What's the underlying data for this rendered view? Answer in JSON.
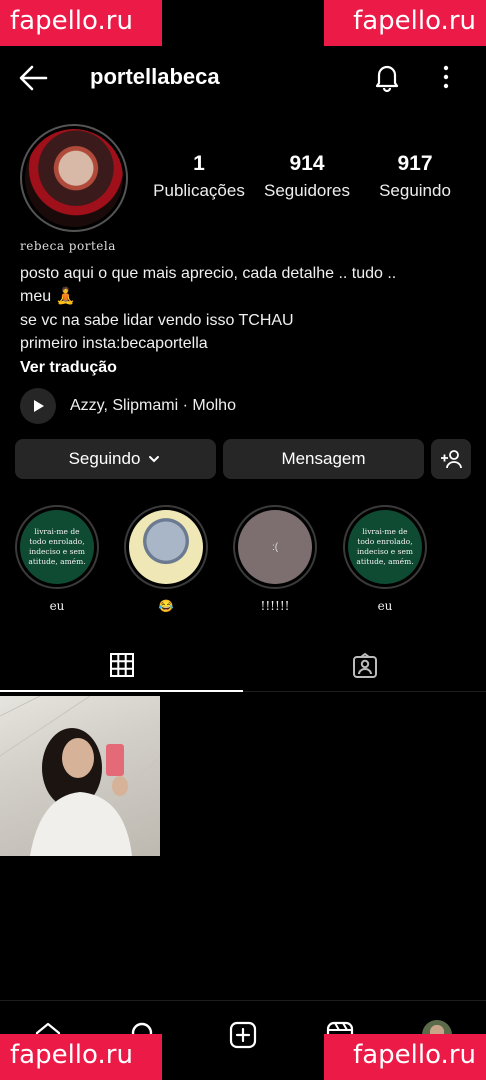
{
  "watermark": "fapello.ru",
  "status_bar": {
    "left_text": "",
    "right_text": ""
  },
  "header": {
    "username": "portellabeca"
  },
  "stats": [
    {
      "value": "1",
      "label": "Publicações"
    },
    {
      "value": "914",
      "label": "Seguidores"
    },
    {
      "value": "917",
      "label": "Seguindo"
    }
  ],
  "bio": {
    "display_name": "rebeca portela",
    "lines": [
      "posto aqui o que mais aprecio, cada detalhe .. tudo ..",
      "meu 🧘",
      "se vc na sabe lidar vendo isso TCHAU",
      "primeiro insta:becaportella"
    ],
    "translate_link": "Ver tradução"
  },
  "music": {
    "label": "Azzy, Slipmami · Molho"
  },
  "actions": {
    "following": "Seguindo",
    "message": "Mensagem"
  },
  "highlights": [
    {
      "cover_text": "livrai-me de todo enrolado, indeciso e sem atitude, amém.",
      "label": "eu"
    },
    {
      "cover_text": "",
      "label": "😂"
    },
    {
      "cover_text": ":(",
      "label": "!!!!!!"
    },
    {
      "cover_text": "livrai-me de todo enrolado, indeciso e sem atitude, amém.",
      "label": "eu"
    }
  ],
  "icons": {
    "back": "back-arrow-icon",
    "bell": "bell-icon",
    "more": "more-vertical-icon",
    "play": "play-icon",
    "chevron": "chevron-down-icon",
    "add_user": "add-user-icon",
    "grid": "grid-icon",
    "tagged": "tagged-icon",
    "home": "home-icon",
    "search": "search-icon",
    "create": "create-icon",
    "reels": "reels-icon"
  },
  "colors": {
    "background": "#000000",
    "button": "#262626",
    "watermark": "#ec1a47",
    "highlight_green": "#0f4a33"
  }
}
